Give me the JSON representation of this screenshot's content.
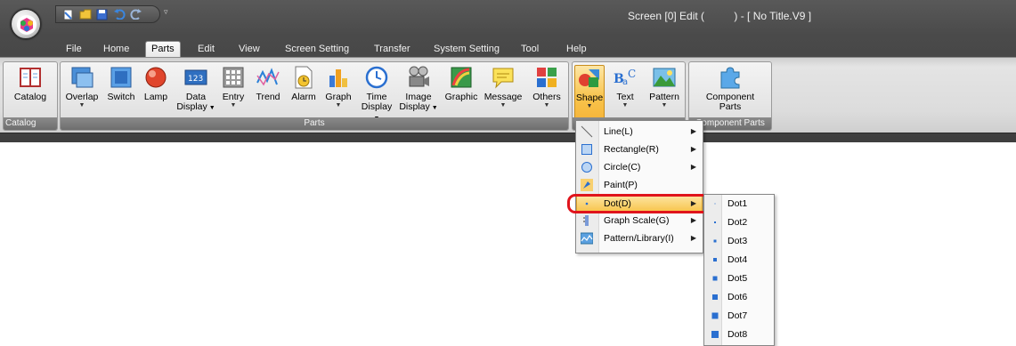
{
  "window": {
    "title": "Screen [0] Edit (          ) - [ No Title.V9 ]"
  },
  "quick_access": {
    "icons": [
      "new-icon",
      "open-icon",
      "save-icon",
      "undo-icon",
      "redo-icon"
    ]
  },
  "menubar": {
    "items": [
      "File",
      "Home",
      "Parts",
      "Edit",
      "View",
      "Screen Setting",
      "Transfer",
      "System Setting",
      "Tool",
      "Help"
    ],
    "active": "Parts"
  },
  "ribbon": {
    "groups": [
      "Catalog",
      "Parts",
      "",
      "Component Parts"
    ],
    "catalog": {
      "label": "Catalog"
    },
    "parts": [
      {
        "l1": "Overlap",
        "l2": ""
      },
      {
        "l1": "Switch",
        "l2": ""
      },
      {
        "l1": "Lamp",
        "l2": ""
      },
      {
        "l1": "Data",
        "l2": "Display"
      },
      {
        "l1": "Entry",
        "l2": ""
      },
      {
        "l1": "Trend",
        "l2": ""
      },
      {
        "l1": "Alarm",
        "l2": ""
      },
      {
        "l1": "Graph",
        "l2": ""
      },
      {
        "l1": "Time",
        "l2": "Display"
      },
      {
        "l1": "Image",
        "l2": "Display"
      },
      {
        "l1": "Graphic",
        "l2": ""
      },
      {
        "l1": "Message",
        "l2": ""
      },
      {
        "l1": "Others",
        "l2": ""
      }
    ],
    "drawing": [
      {
        "l1": "Shape"
      },
      {
        "l1": "Text"
      },
      {
        "l1": "Pattern"
      }
    ],
    "component": {
      "l1": "Component",
      "l2": "Parts"
    }
  },
  "shape_menu": {
    "items": [
      "Line(L)",
      "Rectangle(R)",
      "Circle(C)",
      "Paint(P)",
      "Dot(D)",
      "Graph Scale(G)",
      "Pattern/Library(I)"
    ],
    "highlighted": "Dot(D)"
  },
  "dot_submenu": {
    "items": [
      "Dot1",
      "Dot2",
      "Dot3",
      "Dot4",
      "Dot5",
      "Dot6",
      "Dot7",
      "Dot8"
    ]
  },
  "colors": {
    "accent": "#f8c44c",
    "highlight_border": "#e0141c",
    "dot_blue": "#2a6fd0"
  }
}
